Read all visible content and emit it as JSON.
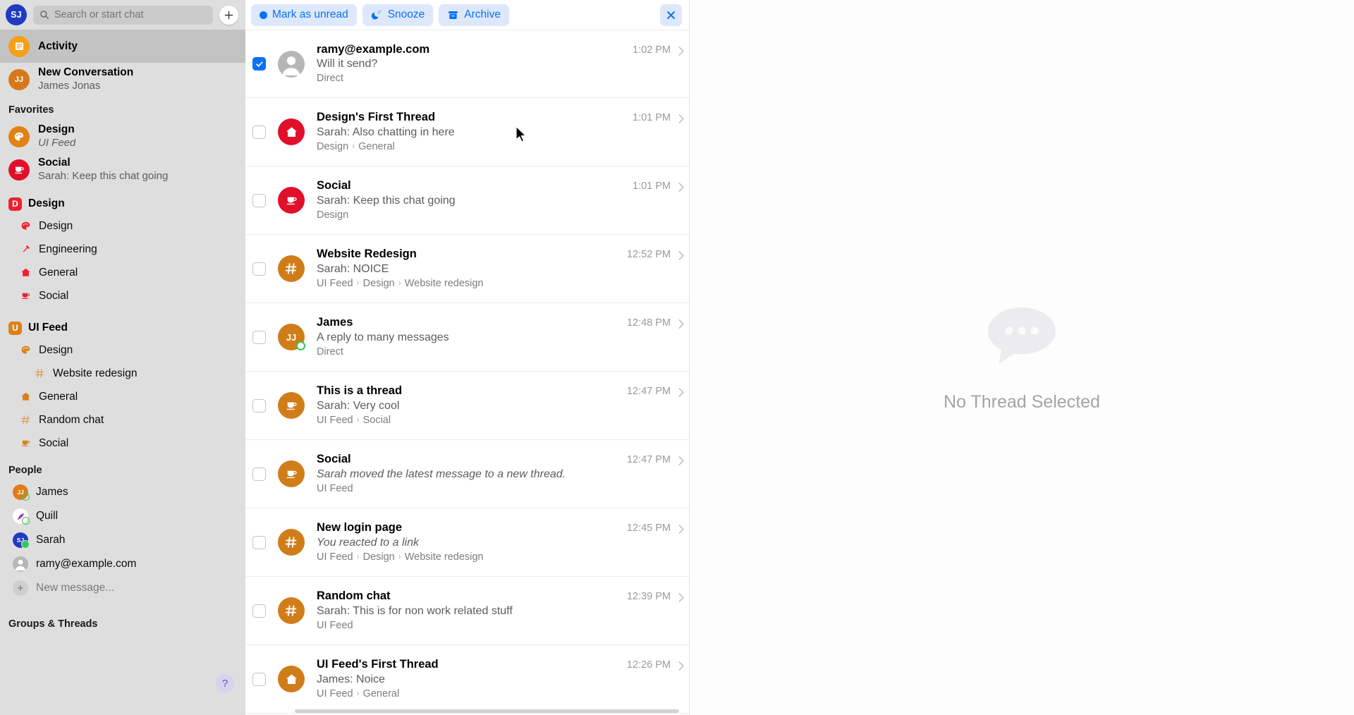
{
  "sidebar": {
    "me_initials": "SJ",
    "search": {
      "placeholder": "Search or start chat",
      "icon": "search-icon"
    },
    "add_button_icon": "plus-icon",
    "activity": {
      "label": "Activity",
      "icon": "activity-icon"
    },
    "new_conversation": {
      "title": "New Conversation",
      "subtitle": "James Jonas",
      "initials": "JJ"
    },
    "favorites_label": "Favorites",
    "favorites": [
      {
        "title": "Design",
        "subtitle": "UI Feed",
        "icon": "palette-icon",
        "color": "#e08214",
        "italic_subtitle": true
      },
      {
        "title": "Social",
        "subtitle": "Sarah: Keep this chat going",
        "icon": "coffee-icon",
        "color": "#e0102a",
        "italic_subtitle": false
      }
    ],
    "workspaces": [
      {
        "name": "Design",
        "badge": "D",
        "color": "#ef2130",
        "channels": [
          {
            "label": "Design",
            "icon": "palette-icon",
            "nested": false
          },
          {
            "label": "Engineering",
            "icon": "hammer-icon",
            "nested": false
          },
          {
            "label": "General",
            "icon": "house-icon",
            "nested": false
          },
          {
            "label": "Social",
            "icon": "coffee-icon",
            "nested": false
          }
        ]
      },
      {
        "name": "UI Feed",
        "badge": "U",
        "color": "#d98119",
        "channels": [
          {
            "label": "Design",
            "icon": "palette-icon",
            "nested": false
          },
          {
            "label": "Website redesign",
            "icon": "hash-icon",
            "nested": true
          },
          {
            "label": "General",
            "icon": "house-icon",
            "nested": false
          },
          {
            "label": "Random chat",
            "icon": "hash-icon",
            "nested": false
          },
          {
            "label": "Social",
            "icon": "coffee-icon",
            "nested": false
          }
        ]
      }
    ],
    "people_label": "People",
    "people": [
      {
        "name": "James",
        "initials": "JJ",
        "color": "#e07b18",
        "presence": "ring"
      },
      {
        "name": "Quill",
        "initials": "",
        "color": "#ffffff",
        "presence": "ring",
        "logo": true
      },
      {
        "name": "Sarah",
        "initials": "SJ",
        "color": "#1f3bc4",
        "presence": "solid"
      },
      {
        "name": "ramy@example.com",
        "initials": "",
        "color": "#b6b6b9",
        "presence": "none",
        "generic": true
      }
    ],
    "new_message_label": "New message...",
    "groups_threads_label": "Groups & Threads",
    "help_label": "?"
  },
  "toolbar": {
    "mark_unread_label": "Mark as unread",
    "snooze_label": "Snooze",
    "archive_label": "Archive",
    "close_label": "✕"
  },
  "threads": [
    {
      "name": "ramy@example.com",
      "preview": "Will it send?",
      "path": [
        "Direct"
      ],
      "time": "1:02 PM",
      "checked": true,
      "avatar": {
        "type": "person-generic",
        "color": "#b6b6b9",
        "initials": ""
      }
    },
    {
      "name": "Design's First Thread",
      "preview": "Sarah: Also chatting in here",
      "path": [
        "Design",
        "General"
      ],
      "time": "1:01 PM",
      "checked": false,
      "avatar": {
        "type": "house-icon",
        "color": "#e0102a",
        "initials": ""
      }
    },
    {
      "name": "Social",
      "preview": "Sarah: Keep this chat going",
      "path": [
        "Design"
      ],
      "time": "1:01 PM",
      "checked": false,
      "avatar": {
        "type": "coffee-icon",
        "color": "#e0102a",
        "initials": ""
      }
    },
    {
      "name": "Website Redesign",
      "preview": "Sarah: NOICE",
      "path": [
        "UI Feed",
        "Design",
        "Website redesign"
      ],
      "time": "12:52 PM",
      "checked": false,
      "avatar": {
        "type": "hash-icon",
        "color": "#d07d19",
        "initials": ""
      }
    },
    {
      "name": "James",
      "preview": "A reply to many messages",
      "path": [
        "Direct"
      ],
      "time": "12:48 PM",
      "checked": false,
      "avatar": {
        "type": "initials",
        "color": "#d07d19",
        "initials": "JJ",
        "presence": "ring"
      }
    },
    {
      "name": "This is a thread",
      "preview": "Sarah: Very cool",
      "path": [
        "UI Feed",
        "Social"
      ],
      "time": "12:47 PM",
      "checked": false,
      "avatar": {
        "type": "coffee-icon",
        "color": "#d07d19",
        "initials": ""
      }
    },
    {
      "name": "Social",
      "preview": "Sarah moved the latest message to a new thread.",
      "path": [
        "UI Feed"
      ],
      "time": "12:47 PM",
      "checked": false,
      "italic": true,
      "avatar": {
        "type": "coffee-icon",
        "color": "#d07d19",
        "initials": ""
      }
    },
    {
      "name": "New login page",
      "preview": "You reacted to a link",
      "path": [
        "UI Feed",
        "Design",
        "Website redesign"
      ],
      "time": "12:45 PM",
      "checked": false,
      "italic": true,
      "avatar": {
        "type": "hash-icon",
        "color": "#d07d19",
        "initials": ""
      }
    },
    {
      "name": "Random chat",
      "preview": "Sarah: This is for non work related stuff",
      "path": [
        "UI Feed"
      ],
      "time": "12:39 PM",
      "checked": false,
      "avatar": {
        "type": "hash-icon",
        "color": "#d07d19",
        "initials": ""
      }
    },
    {
      "name": "UI Feed's First Thread",
      "preview": "James: Noice",
      "path": [
        "UI Feed",
        "General"
      ],
      "time": "12:26 PM",
      "checked": false,
      "avatar": {
        "type": "house-icon",
        "color": "#d07d19",
        "initials": ""
      }
    }
  ],
  "empty_state": {
    "text": "No Thread Selected",
    "icon": "speech-bubble-icon"
  },
  "colors": {
    "accent_blue": "#0a70f5",
    "toolbar_pill_bg": "#dde8fd",
    "sidebar_bg": "#dededf",
    "selected_row": "#c3c3c4"
  }
}
